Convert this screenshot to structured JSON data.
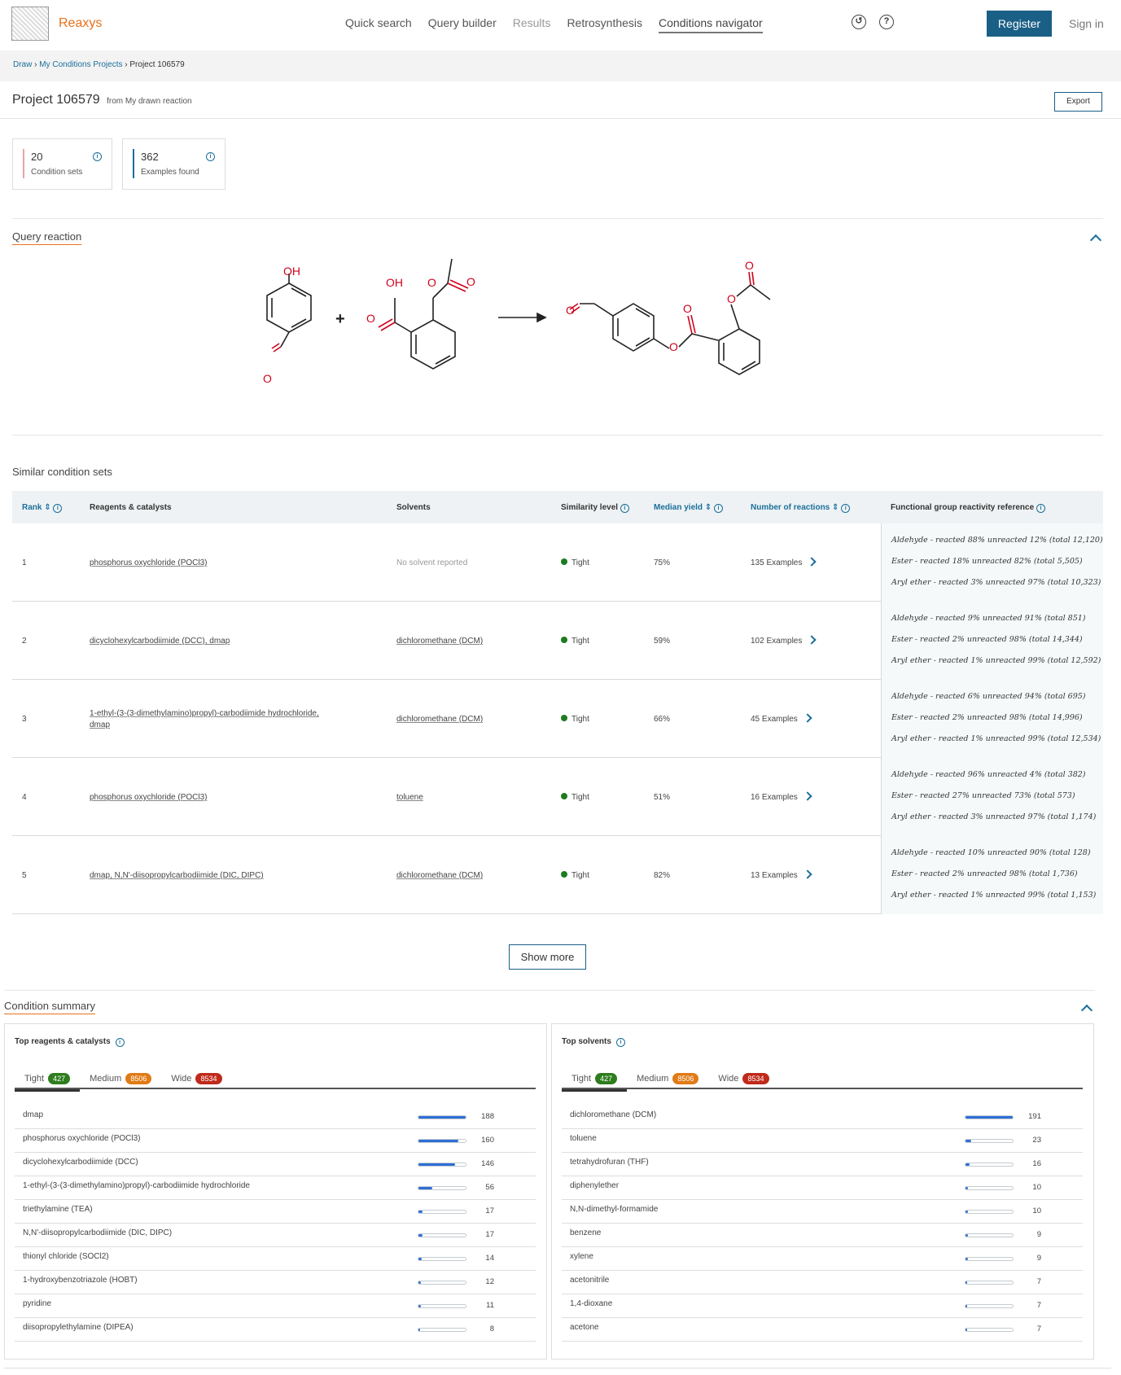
{
  "header": {
    "brand": "Reaxys",
    "nav": [
      "Quick search",
      "Query builder",
      "Results",
      "Retrosynthesis",
      "Conditions navigator"
    ],
    "register": "Register",
    "signin": "Sign in",
    "history_icon": "history-icon",
    "help_icon": "help-icon"
  },
  "breadcrumb": {
    "items": [
      "Draw",
      "My Conditions Projects",
      "Project 106579"
    ]
  },
  "project": {
    "title": "Project 106579",
    "subtitle": "from My drawn reaction",
    "export": "Export"
  },
  "stats": [
    {
      "value": "20",
      "label": "Condition sets",
      "color": "#e9a3a3"
    },
    {
      "value": "362",
      "label": "Examples found",
      "color": "#1a6f9a"
    }
  ],
  "query_reaction": {
    "title": "Query reaction",
    "reactant1": {
      "oh": "OH",
      "o": "O"
    },
    "reactant2": {
      "oh": "OH",
      "o1": "O",
      "o2": "O",
      "o3": "O"
    },
    "plus": "+",
    "product": {
      "o1": "O",
      "o2": "O",
      "o3": "O",
      "o4": "O",
      "o5": "O"
    }
  },
  "similar": {
    "title": "Similar condition sets",
    "columns": {
      "rank": "Rank",
      "reagents": "Reagents & catalysts",
      "solvents": "Solvents",
      "similarity": "Similarity level",
      "yield": "Median yield",
      "reactions": "Number of reactions",
      "fg": "Functional group reactivity reference"
    },
    "rows": [
      {
        "rank": "1",
        "reagents": "phosphorus oxychloride (POCl3)",
        "reagents2": "",
        "solvents": "No solvent reported",
        "similarity": "Tight",
        "yield": "75%",
        "reactions": "135 Examples",
        "fg": [
          "Aldehyde - reacted 88% unreacted 12% (total 12,120)",
          "Ester - reacted 18% unreacted 82% (total 5,505)",
          "Aryl ether - reacted 3% unreacted 97% (total 10,323)"
        ]
      },
      {
        "rank": "2",
        "reagents": "dicyclohexylcarbodiimide (DCC), dmap",
        "reagents2": "",
        "solvents": "dichloromethane (DCM)",
        "similarity": "Tight",
        "yield": "59%",
        "reactions": "102 Examples",
        "fg": [
          "Aldehyde - reacted 9% unreacted 91% (total 851)",
          "Ester - reacted 2% unreacted 98% (total 14,344)",
          "Aryl ether - reacted 1% unreacted 99% (total 12,592)"
        ]
      },
      {
        "rank": "3",
        "reagents": "1-ethyl-(3-(3-dimethylamino)propyl)-carbodiimide hydrochloride,",
        "reagents2": "dmap",
        "solvents": "dichloromethane (DCM)",
        "similarity": "Tight",
        "yield": "66%",
        "reactions": "45 Examples",
        "fg": [
          "Aldehyde - reacted 6% unreacted 94% (total 695)",
          "Ester - reacted 2% unreacted 98% (total 14,996)",
          "Aryl ether - reacted 1% unreacted 99% (total 12,534)"
        ]
      },
      {
        "rank": "4",
        "reagents": "phosphorus oxychloride (POCl3)",
        "reagents2": "",
        "solvents": "toluene",
        "similarity": "Tight",
        "yield": "51%",
        "reactions": "16 Examples",
        "fg": [
          "Aldehyde - reacted 96% unreacted 4% (total 382)",
          "Ester - reacted 27% unreacted 73% (total 573)",
          "Aryl ether - reacted 3% unreacted 97% (total 1,174)"
        ]
      },
      {
        "rank": "5",
        "reagents": "dmap, N,N'-diisopropylcarbodiimide (DIC, DIPC)",
        "reagents2": "",
        "solvents": "dichloromethane (DCM)",
        "similarity": "Tight",
        "yield": "82%",
        "reactions": "13 Examples",
        "fg": [
          "Aldehyde - reacted 10% unreacted 90% (total 128)",
          "Ester - reacted 2% unreacted 98% (total 1,736)",
          "Aryl ether - reacted 1% unreacted 99% (total 1,153)"
        ]
      }
    ],
    "show_more": "Show more"
  },
  "summary": {
    "title": "Condition summary",
    "tabs": [
      {
        "label": "Tight",
        "count": "427",
        "color": "#2e7d1e"
      },
      {
        "label": "Medium",
        "count": "8506",
        "color": "#e07b15"
      },
      {
        "label": "Wide",
        "count": "8534",
        "color": "#c02a1b"
      }
    ],
    "reagents": {
      "title": "Top reagents & catalysts",
      "max": 188,
      "items": [
        {
          "name": "dmap",
          "count": 188
        },
        {
          "name": "phosphorus oxychloride (POCl3)",
          "count": 160
        },
        {
          "name": "dicyclohexylcarbodiimide (DCC)",
          "count": 146
        },
        {
          "name": "1-ethyl-(3-(3-dimethylamino)propyl)-carbodiimide hydrochloride",
          "count": 56
        },
        {
          "name": "triethylamine (TEA)",
          "count": 17
        },
        {
          "name": "N,N'-diisopropylcarbodiimide (DIC, DIPC)",
          "count": 17
        },
        {
          "name": "thionyl chloride (SOCl2)",
          "count": 14
        },
        {
          "name": "1-hydroxybenzotriazole (HOBT)",
          "count": 12
        },
        {
          "name": "pyridine",
          "count": 11
        },
        {
          "name": "diisopropylethylamine (DIPEA)",
          "count": 8
        }
      ]
    },
    "solvents": {
      "title": "Top solvents",
      "max": 191,
      "items": [
        {
          "name": "dichloromethane (DCM)",
          "count": 191
        },
        {
          "name": "toluene",
          "count": 23
        },
        {
          "name": "tetrahydrofuran (THF)",
          "count": 16
        },
        {
          "name": "diphenylether",
          "count": 10
        },
        {
          "name": "N,N-dimethyl-formamide",
          "count": 10
        },
        {
          "name": "benzene",
          "count": 9
        },
        {
          "name": "xylene",
          "count": 9
        },
        {
          "name": "acetonitrile",
          "count": 7
        },
        {
          "name": "1,4-dioxane",
          "count": 7
        },
        {
          "name": "acetone",
          "count": 7
        }
      ]
    }
  }
}
